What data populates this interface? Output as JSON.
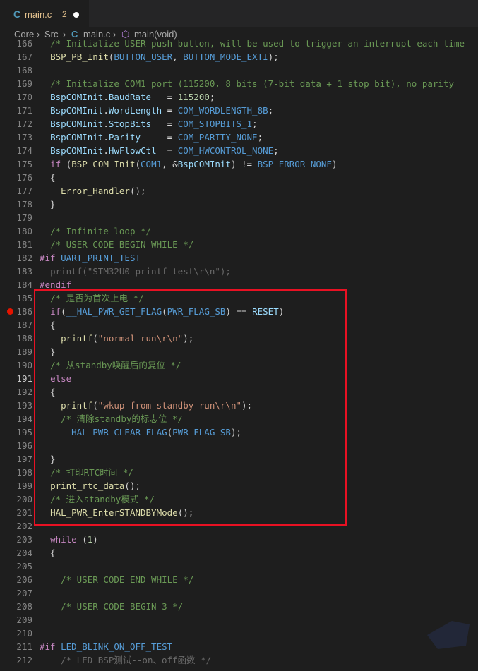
{
  "tab": {
    "icon_label": "C",
    "filename": "main.c",
    "modified_count": "2"
  },
  "breadcrumb": {
    "seg1": "Core",
    "seg2": "Src",
    "seg3": "main.c",
    "seg4": "main(void)",
    "c_icon": "C"
  },
  "lines": [
    {
      "n": "166",
      "html": "<span class=\"cm\">  /* Initialize USER push-button, will be used to trigger an interrupt each time</span>"
    },
    {
      "n": "167",
      "html": "  <span class=\"fn\">BSP_PB_Init</span>(<span class=\"mac\">BUTTON_USER</span>, <span class=\"mac\">BUTTON_MODE_EXTI</span>);"
    },
    {
      "n": "168",
      "html": ""
    },
    {
      "n": "169",
      "html": "  <span class=\"cm\">/* Initialize COM1 port (115200, 8 bits (7-bit data + 1 stop bit), no parity</span>"
    },
    {
      "n": "170",
      "html": "  <span class=\"var\">BspCOMInit</span>.<span class=\"var\">BaudRate</span>   = <span class=\"num\">115200</span>;"
    },
    {
      "n": "171",
      "html": "  <span class=\"var\">BspCOMInit</span>.<span class=\"var\">WordLength</span> = <span class=\"mac\">COM_WORDLENGTH_8B</span>;"
    },
    {
      "n": "172",
      "html": "  <span class=\"var\">BspCOMInit</span>.<span class=\"var\">StopBits</span>   = <span class=\"mac\">COM_STOPBITS_1</span>;"
    },
    {
      "n": "173",
      "html": "  <span class=\"var\">BspCOMInit</span>.<span class=\"var\">Parity</span>     = <span class=\"mac\">COM_PARITY_NONE</span>;"
    },
    {
      "n": "174",
      "html": "  <span class=\"var\">BspCOMInit</span>.<span class=\"var\">HwFlowCtl</span>  = <span class=\"mac\">COM_HWCONTROL_NONE</span>;"
    },
    {
      "n": "175",
      "html": "  <span class=\"kw\">if</span> (<span class=\"fn\">BSP_COM_Init</span>(<span class=\"mac\">COM1</span>, &amp;<span class=\"var\">BspCOMInit</span>) != <span class=\"mac\">BSP_ERROR_NONE</span>)"
    },
    {
      "n": "176",
      "html": "  {"
    },
    {
      "n": "177",
      "html": "    <span class=\"fn\">Error_Handler</span>();"
    },
    {
      "n": "178",
      "html": "  }"
    },
    {
      "n": "179",
      "html": ""
    },
    {
      "n": "180",
      "html": "  <span class=\"cm\">/* Infinite loop */</span>"
    },
    {
      "n": "181",
      "html": "  <span class=\"cm\">/* USER CODE BEGIN WHILE */</span>"
    },
    {
      "n": "182",
      "html": "<span class=\"pp\">#if</span> <span class=\"mac\">UART_PRINT_TEST</span>"
    },
    {
      "n": "183",
      "html": "  <span class=\"dim\">printf(\"STM32U0 printf test\\r\\n\");</span>"
    },
    {
      "n": "184",
      "html": "<span class=\"pp\">#endif</span>"
    },
    {
      "n": "185",
      "html": "  <span class=\"cm\">/* 是否为首次上电 */</span>"
    },
    {
      "n": "186",
      "bp": true,
      "html": "  <span class=\"kw\">if</span>(<span class=\"mac\">__HAL_PWR_GET_FLAG</span>(<span class=\"mac\">PWR_FLAG_SB</span>) == <span class=\"var\">RESET</span>)"
    },
    {
      "n": "187",
      "html": "  {"
    },
    {
      "n": "188",
      "html": "    <span class=\"fn\">printf</span>(<span class=\"str\">\"normal run\\r\\n\"</span>);"
    },
    {
      "n": "189",
      "html": "  }"
    },
    {
      "n": "190",
      "html": "  <span class=\"cm\">/* 从standby唤醒后的复位 */</span>"
    },
    {
      "n": "191",
      "active": true,
      "html": "  <span class=\"kw\">else</span>"
    },
    {
      "n": "192",
      "html": "  {"
    },
    {
      "n": "193",
      "html": "    <span class=\"fn\">printf</span>(<span class=\"str\">\"wkup from standby run\\r\\n\"</span>);"
    },
    {
      "n": "194",
      "html": "    <span class=\"cm\">/* 清除standby的标志位 */</span>"
    },
    {
      "n": "195",
      "html": "    <span class=\"mac\">__HAL_PWR_CLEAR_FLAG</span>(<span class=\"mac\">PWR_FLAG_SB</span>);"
    },
    {
      "n": "196",
      "html": ""
    },
    {
      "n": "197",
      "html": "  }"
    },
    {
      "n": "198",
      "html": "  <span class=\"cm\">/* 打印RTC时间 */</span>"
    },
    {
      "n": "199",
      "html": "  <span class=\"fn\">print_rtc_data</span>();"
    },
    {
      "n": "200",
      "html": "  <span class=\"cm\">/* 进入standby模式 */</span>"
    },
    {
      "n": "201",
      "html": "  <span class=\"fn\">HAL_PWR_EnterSTANDBYMode</span>();"
    },
    {
      "n": "202",
      "html": ""
    },
    {
      "n": "203",
      "html": "  <span class=\"kw\">while</span> (<span class=\"num\">1</span>)"
    },
    {
      "n": "204",
      "html": "  {"
    },
    {
      "n": "205",
      "html": ""
    },
    {
      "n": "206",
      "html": "    <span class=\"cm\">/* USER CODE END WHILE */</span>"
    },
    {
      "n": "207",
      "html": ""
    },
    {
      "n": "208",
      "html": "    <span class=\"cm\">/* USER CODE BEGIN 3 */</span>"
    },
    {
      "n": "209",
      "html": ""
    },
    {
      "n": "210",
      "html": ""
    },
    {
      "n": "211",
      "html": "<span class=\"pp\">#if</span> <span class=\"mac\">LED_BLINK_ON_OFF_TEST</span>"
    },
    {
      "n": "212",
      "html": "    <span class=\"dim\">/* LED BSP测试--on、off函数 */</span>"
    }
  ]
}
